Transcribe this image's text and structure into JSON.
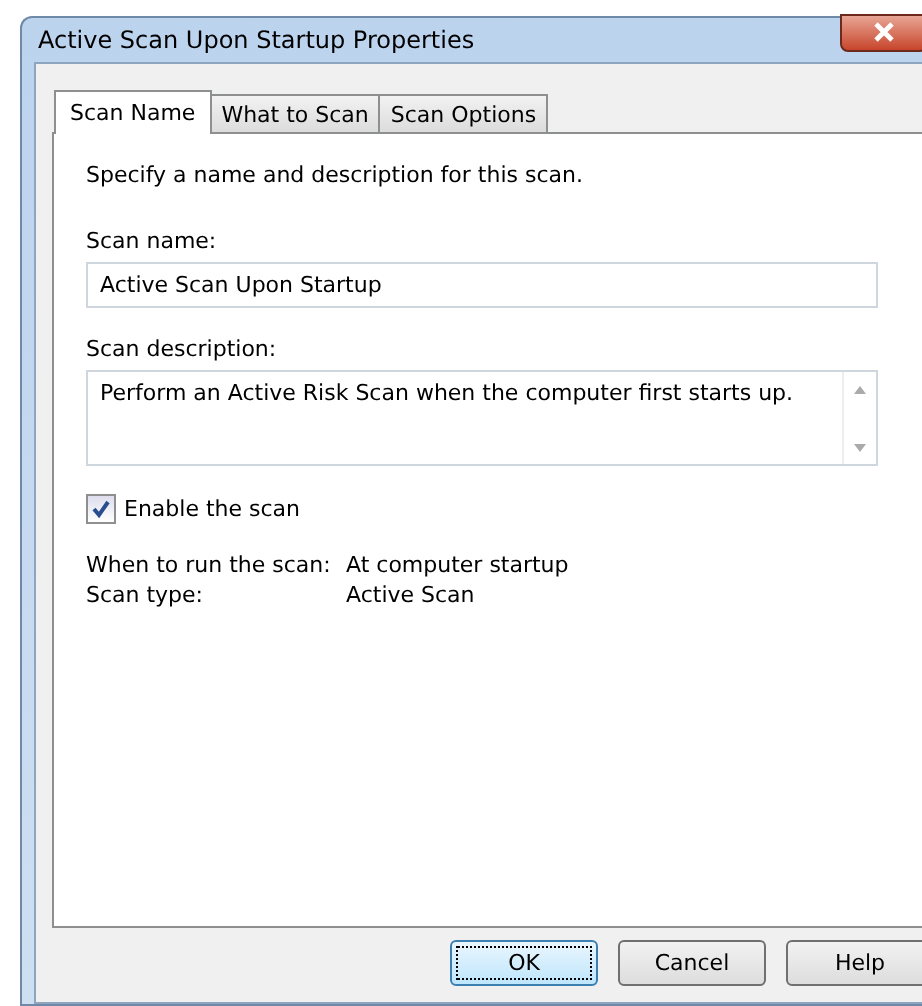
{
  "window": {
    "title": "Active Scan Upon Startup Properties"
  },
  "tabs": [
    {
      "label": "Scan Name",
      "selected": true
    },
    {
      "label": "What to Scan",
      "selected": false
    },
    {
      "label": "Scan Options",
      "selected": false
    }
  ],
  "intro": "Specify a name and description for this scan.",
  "name_field": {
    "label": "Scan name:",
    "value": "Active Scan Upon Startup"
  },
  "description_field": {
    "label": "Scan description:",
    "value": "Perform an Active Risk Scan when the computer first starts up."
  },
  "enable": {
    "label": "Enable the scan",
    "checked": true
  },
  "info": [
    {
      "label": "When to run the scan:",
      "value": "At computer startup"
    },
    {
      "label": "Scan type:",
      "value": "Active Scan"
    }
  ],
  "buttons": [
    {
      "label": "OK",
      "default": true
    },
    {
      "label": "Cancel",
      "default": false
    },
    {
      "label": "Help",
      "default": false
    }
  ]
}
